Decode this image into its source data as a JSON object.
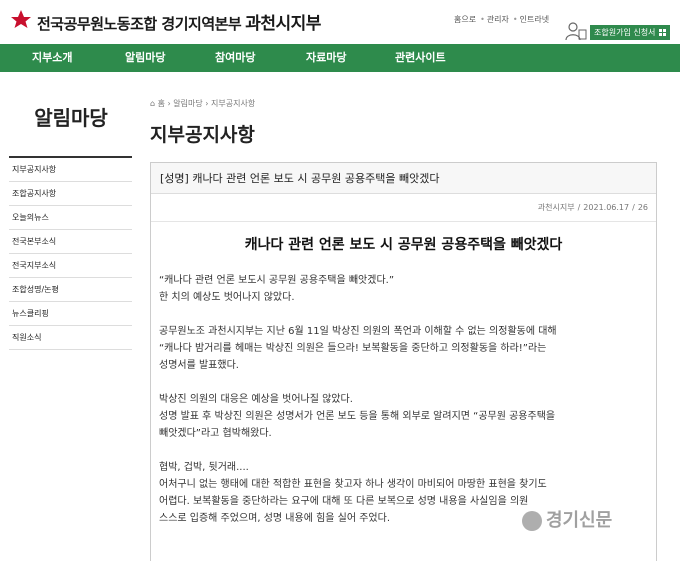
{
  "header": {
    "org_name": "전국공무원노동조합 경기지역본부",
    "branch_name": "과천시지부",
    "top_links": [
      "홈으로",
      "관리자",
      "인트라넷"
    ],
    "join_label": "조합원가입 신청서",
    "brand_color": "#2e8b4c",
    "logo_color": "#c8102e"
  },
  "nav": {
    "items": [
      "지부소개",
      "알림마당",
      "참여마당",
      "자료마당",
      "관련사이트"
    ]
  },
  "sidebar": {
    "title": "알림마당",
    "items": [
      "지부공지사항",
      "조합공지사항",
      "오늘의뉴스",
      "전국본부소식",
      "전국지부소식",
      "조합성명/논평",
      "뉴스클리핑",
      "직원소식"
    ]
  },
  "breadcrumb": {
    "home": "홈",
    "level1": "알림마당",
    "level2": "지부공지사항"
  },
  "page_title": "지부공지사항",
  "article": {
    "title": "[성명] 캐나다 관련 언론 보도 시 공무원 공용주택을 빼앗겠다",
    "author": "과천시지부",
    "date": "2021.06.17",
    "views": "26",
    "heading": "캐나다 관련 언론 보도 시 공무원 공용주택을 빼앗겠다",
    "paragraphs": [
      [
        "“캐나다 관련 언론 보도시 공무원 공용주택을 빼앗겠다.”",
        "한 치의 예상도 벗어나지 않았다."
      ],
      [
        "공무원노조 과천시지부는 지난 6월 11일 박상진 의원의 폭언과 이해할 수 없는 의정활동에 대해",
        "“캐나다 밤거리를 헤매는 박상진 의원은 들으라! 보복활동을 중단하고 의정활동을 하라!”라는",
        "성명서를 발표했다."
      ],
      [
        "박상진 의원의 대응은 예상을 벗어나질 않았다.",
        "성명 발표 후 박상진 의원은 성명서가 언론 보도 등을 통해 외부로 알려지면 “공무원 공용주택을",
        "빼앗겠다”라고 협박해왔다."
      ],
      [
        "협박, 겁박, 뒷거래....",
        "어처구니 없는 행태에 대한 적합한 표현을 찾고자 하나 생각이 마비되어 마땅한 표현을 찾기도",
        "어렵다. 보복활동을 중단하라는 요구에 대해 또 다른 보복으로 성명 내용을 사실임을 의원",
        "스스로 입증해 주었으며, 성명 내용에 힘을 실어 주었다."
      ]
    ]
  },
  "watermark": "경기신문"
}
